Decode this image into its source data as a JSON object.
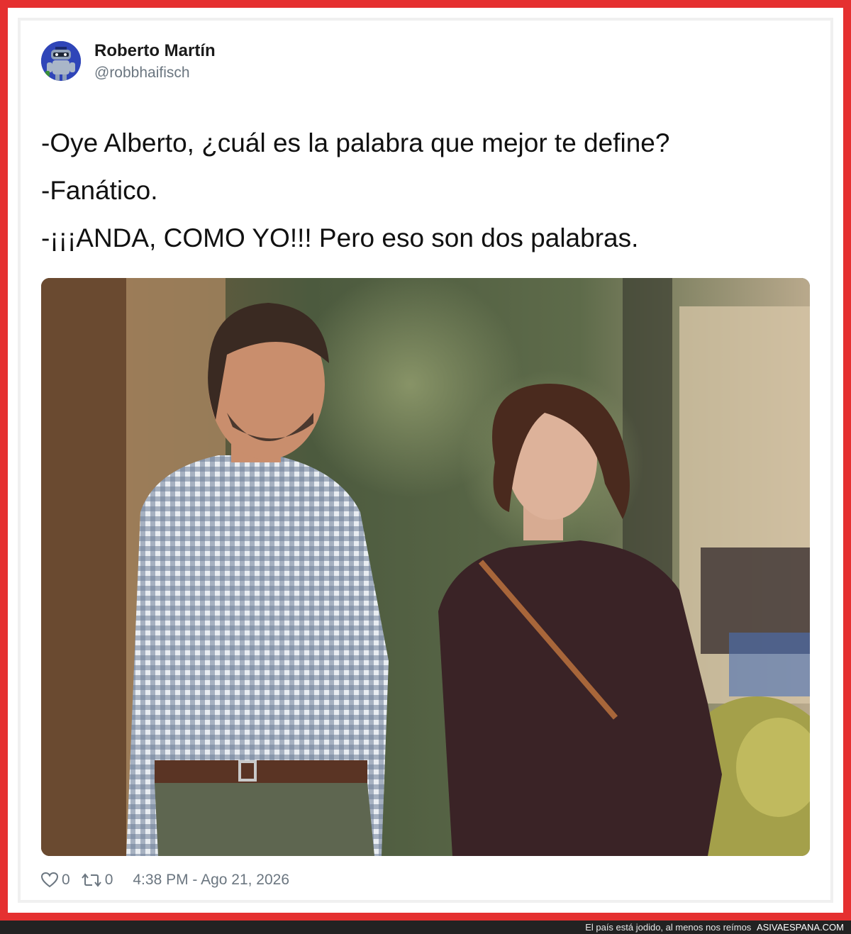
{
  "tweet": {
    "author": {
      "name": "Roberto Martín",
      "handle": "@robbhaifisch",
      "avatar_color": "#2f45b8"
    },
    "text_lines": [
      "-Oye Alberto, ¿cuál es la palabra que mejor te define?",
      "-Fanático.",
      "-¡¡¡ANDA, COMO YO!!! Pero eso son dos palabras."
    ],
    "stats": {
      "likes": "0",
      "retweets": "0",
      "like_icon": "heart-icon",
      "retweet_icon": "retweet-icon"
    },
    "timestamp": "4:38 PM - Ago 21, 2026"
  },
  "watermark": {
    "tagline": "El país está jodido, al menos nos reímos",
    "site": "ASIVAESPANA.COM"
  },
  "colors": {
    "frame": "#e53030",
    "text": "#111111",
    "muted": "#6b7680",
    "bar": "#222222"
  }
}
